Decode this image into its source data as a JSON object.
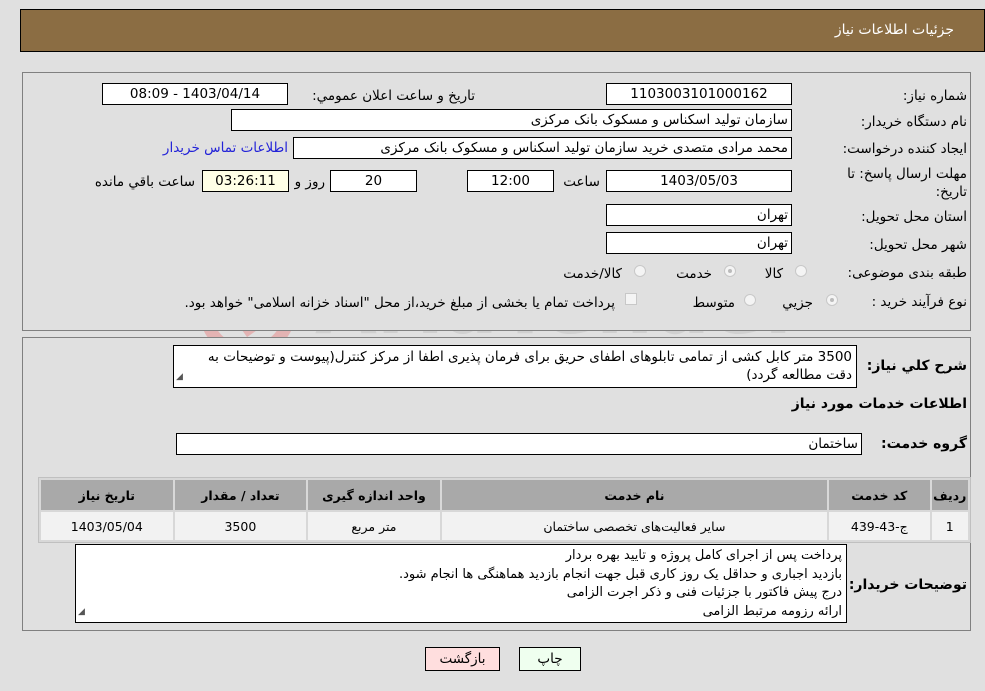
{
  "header": {
    "title": "جزئیات اطلاعات نیاز"
  },
  "details": {
    "need_number_label": "شماره نیاز:",
    "need_number": "1103003101000162",
    "announce_label": "تاریخ و ساعت اعلان عمومي:",
    "announce_value": "1403/04/14 - 08:09",
    "buyer_org_label": "نام دستگاه خریدار:",
    "buyer_org": "سازمان تولید اسکناس و مسکوک بانک مرکزی",
    "creator_label": "ایجاد کننده درخواست:",
    "creator": "محمد مرادی متصدی خرید سازمان تولید اسکناس و مسکوک بانک مرکزی",
    "contact_link": "اطلاعات تماس خریدار",
    "deadline_label": "مهلت ارسال پاسخ: تا تاریخ:",
    "deadline_date": "1403/05/03",
    "time_label": "ساعت",
    "deadline_time": "12:00",
    "days": "20",
    "days_label": "روز و",
    "remaining_time": "03:26:11",
    "remaining_label": "ساعت باقي مانده",
    "province_label": "استان محل تحویل:",
    "province": "تهران",
    "city_label": "شهر محل تحویل:",
    "city": "تهران",
    "category_label": "طبقه بندی موضوعی:",
    "category_options": [
      "کالا",
      "خدمت",
      "کالا/خدمت"
    ],
    "category_selected": "خدمت",
    "process_label": "نوع فرآیند خرید :",
    "process_options": [
      "جزيي",
      "متوسط"
    ],
    "process_selected": "جزيي",
    "treasury_note": "پرداخت تمام یا بخشی از مبلغ خرید،از محل \"اسناد خزانه اسلامی\" خواهد بود."
  },
  "description": {
    "label": "شرح کلي نیاز:",
    "text": "3500 متر کابل کشی از تمامی تابلوهای اطفای حریق برای فرمان پذیری اطفا از مرکز کنترل(پیوست و توضیحات به دقت مطالعه گردد)"
  },
  "services": {
    "section_title": "اطلاعات خدمات مورد نیاز",
    "group_label": "گروه خدمت:",
    "group_value": "ساختمان",
    "columns": [
      "ردیف",
      "کد خدمت",
      "نام خدمت",
      "واحد اندازه گیری",
      "تعداد / مقدار",
      "تاریخ نیاز"
    ],
    "rows": [
      [
        "1",
        "ج-43-439",
        "سایر فعالیت‌های تخصصی ساختمان",
        "متر مربع",
        "3500",
        "1403/05/04"
      ]
    ]
  },
  "buyer_notes": {
    "label": "توضیحات خریدار:",
    "lines": [
      "پرداخت پس از اجرای کامل پروژه و تایید بهره بردار",
      "بازدید اجباری و حداقل یک روز کاری قبل جهت انجام بازدید هماهنگی ها انجام شود.",
      "درج پیش فاکتور با جزئیات فنی و ذکر اجرت الزامی",
      "ارائه رزومه مرتبط الزامی"
    ]
  },
  "buttons": {
    "print": "چاپ",
    "back": "بازگشت"
  },
  "watermark": {
    "text": "AriaTender.neT"
  },
  "colors": {
    "header_bg": "#8b6d43",
    "link": "#2323d8",
    "print_bg": "#efffef",
    "back_bg": "#ffdede",
    "timer_bg": "#ffffe6"
  }
}
